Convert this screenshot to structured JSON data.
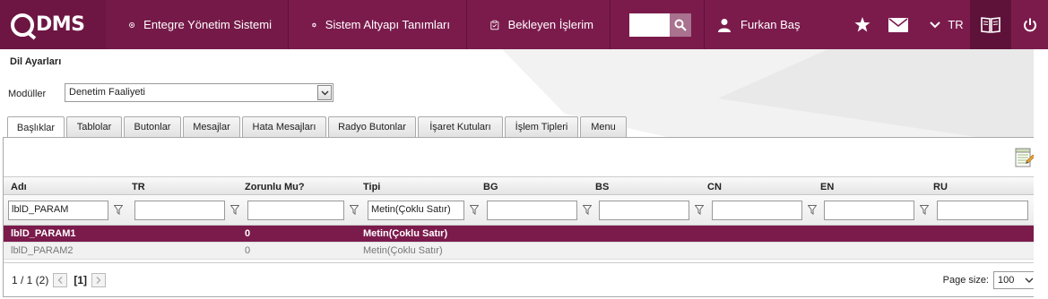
{
  "brand": {
    "logo_text": "DMS"
  },
  "nav": {
    "items": [
      {
        "label": "Entegre Yönetim Sistemi",
        "icon": "target-icon"
      },
      {
        "label": "Sistem Altyapı Tanımları",
        "icon": "gear-icon"
      },
      {
        "label": "Bekleyen İşlerim",
        "icon": "clipboard-icon"
      }
    ],
    "search_placeholder": "",
    "user_name": "Furkan Baş",
    "language": "TR"
  },
  "page": {
    "title": "Dil Ayarları",
    "module_label": "Modüller",
    "module_selected": "Denetim Faaliyeti"
  },
  "tabs": [
    {
      "label": "Başlıklar",
      "active": true
    },
    {
      "label": "Tablolar"
    },
    {
      "label": "Butonlar"
    },
    {
      "label": "Mesajlar"
    },
    {
      "label": "Hata Mesajları"
    },
    {
      "label": "Radyo Butonlar"
    },
    {
      "label": "İşaret Kutuları"
    },
    {
      "label": "İşlem Tipleri"
    },
    {
      "label": "Menu"
    }
  ],
  "grid": {
    "columns": [
      "Adı",
      "TR",
      "Zorunlu Mu?",
      "Tipi",
      "BG",
      "BS",
      "CN",
      "EN",
      "RU"
    ],
    "filters": [
      "lblD_PARAM",
      "",
      "",
      "Metin(Çoklu Satır)",
      "",
      "",
      "",
      "",
      ""
    ],
    "rows": [
      [
        "lblD_PARAM1",
        "",
        "0",
        "Metin(Çoklu Satır)",
        "",
        "",
        "",
        "",
        ""
      ],
      [
        "lblD_PARAM2",
        "",
        "0",
        "Metin(Çoklu Satır)",
        "",
        "",
        "",
        "",
        ""
      ]
    ],
    "selected_row": 0
  },
  "pager": {
    "info": "1 / 1 (2)",
    "current": "[1]",
    "page_size_label": "Page size:",
    "page_size": "100"
  },
  "colors": {
    "brand": "#7b1b4c",
    "brand_dark": "#5e1239"
  }
}
